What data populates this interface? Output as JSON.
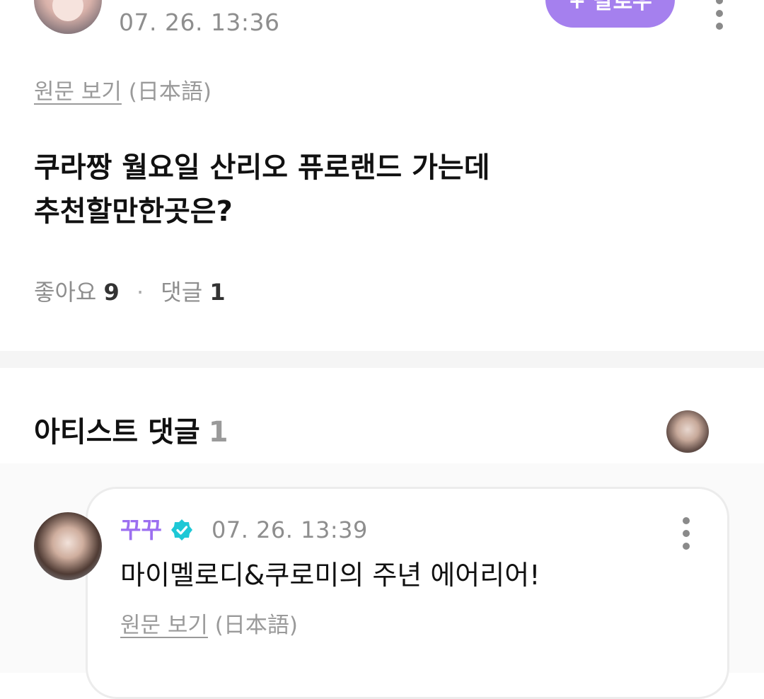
{
  "post": {
    "timestamp": "07. 26. 13:36",
    "follow_label": "+ 팔로우",
    "original_link": "원문 보기",
    "original_lang": "(日本語)",
    "body_lines": [
      "쿠라짱 월요일 산리오 퓨로랜드 가는데",
      "추천할만한곳은?"
    ],
    "likes_label": "좋아요",
    "likes_count": "9",
    "comments_label": "댓글",
    "comments_count": "1"
  },
  "artist_comments": {
    "title": "아티스트 댓글",
    "count": "1"
  },
  "comment": {
    "author": "꾸꾸",
    "timestamp": "07. 26. 13:39",
    "text": "마이멜로디&쿠로미의 주년 에어리어!",
    "original_link": "원문 보기",
    "original_lang": "(日本語)"
  },
  "colors": {
    "accent": "#a580ee",
    "author": "#9c6ff0",
    "verified": "#1ec8d6",
    "muted_text": "#8e8e8e"
  },
  "icons": {
    "post_more": "more-vertical-icon",
    "comment_more": "more-vertical-icon",
    "verified": "verified-badge-icon"
  }
}
